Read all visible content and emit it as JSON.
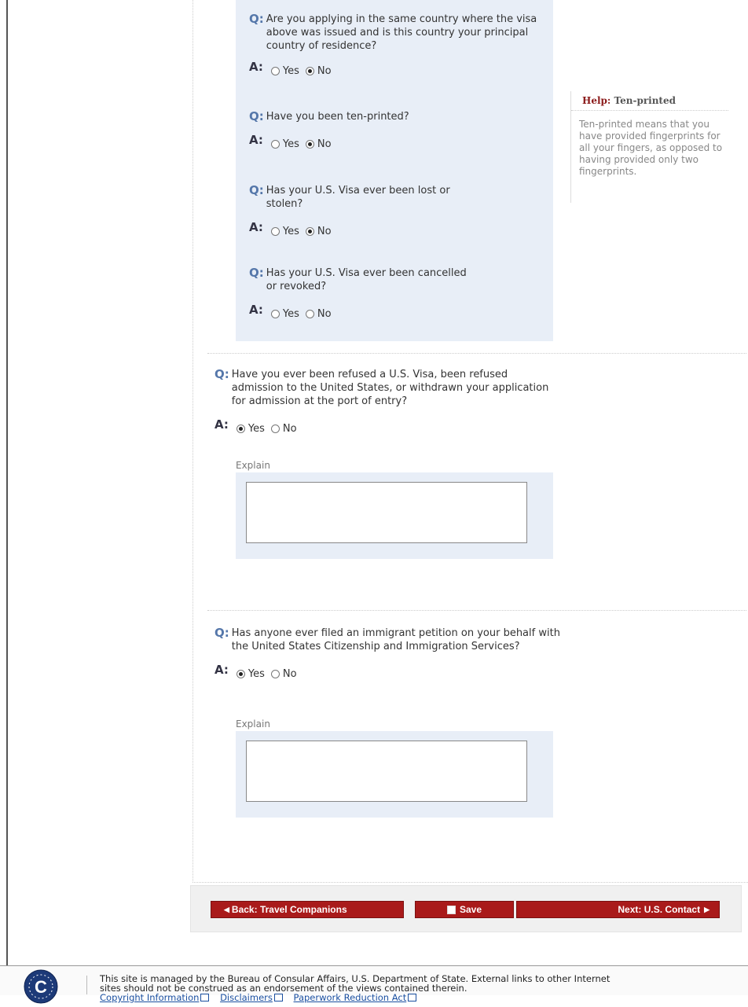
{
  "questions_inner": [
    {
      "q": "Are you applying in the same country where the visa above was issued and is this country your principal country of residence?",
      "yes": "Yes",
      "no": "No",
      "selected": "no"
    },
    {
      "q": "Have you been ten-printed?",
      "yes": "Yes",
      "no": "No",
      "selected": "no"
    },
    {
      "q": "Has your U.S. Visa ever been lost or stolen?",
      "yes": "Yes",
      "no": "No",
      "selected": "no"
    },
    {
      "q": "Has your U.S. Visa ever been cancelled or revoked?",
      "yes": "Yes",
      "no": "No",
      "selected": "none"
    }
  ],
  "labels": {
    "q": "Q:",
    "a": "A:"
  },
  "help": {
    "prefix": "Help:",
    "title": "Ten-printed",
    "body": "Ten-printed means that you have provided fingerprints for all your fingers, as opposed to having provided only two fingerprints."
  },
  "questions_outer": [
    {
      "q": "Have you ever been refused a U.S. Visa, been refused admission to the United States, or withdrawn your application for admission at the port of entry?",
      "yes": "Yes",
      "no": "No",
      "selected": "yes",
      "explain_label": "Explain",
      "explain_value": ""
    },
    {
      "q": "Has anyone ever filed an immigrant petition on your behalf with the United States Citizenship and Immigration Services?",
      "yes": "Yes",
      "no": "No",
      "selected": "yes",
      "explain_label": "Explain",
      "explain_value": ""
    }
  ],
  "buttons": {
    "back": "Back: Travel Companions",
    "save": "Save",
    "next": "Next: U.S. Contact"
  },
  "footer": {
    "text_line1": "This site is managed by the Bureau of Consular Affairs, U.S. Department of State. External links to other Internet",
    "text_line2": "sites should not be construed as an endorsement of the views contained therein.",
    "links": [
      "Copyright Information",
      "Disclaimers",
      "Paperwork Reduction Act"
    ],
    "logo_letter": "C"
  },
  "colors": {
    "accent": "#a91a1a",
    "panel": "#e8eef7",
    "q_label": "#5577aa",
    "link": "#1a4fa0"
  }
}
